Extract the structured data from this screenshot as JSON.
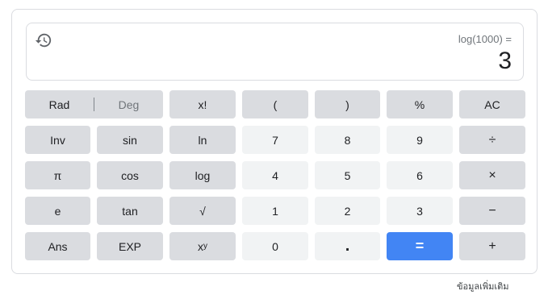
{
  "display": {
    "expression": "log(1000) =",
    "result": "3"
  },
  "buttons": {
    "rad": "Rad",
    "deg": "Deg",
    "factorial": "x!",
    "open_paren": "(",
    "close_paren": ")",
    "percent": "%",
    "all_clear": "AC",
    "inv": "Inv",
    "sin": "sin",
    "ln": "ln",
    "seven": "7",
    "eight": "8",
    "nine": "9",
    "divide": "÷",
    "pi": "π",
    "cos": "cos",
    "log": "log",
    "four": "4",
    "five": "5",
    "six": "6",
    "multiply": "×",
    "e": "e",
    "tan": "tan",
    "sqrt": "√",
    "one": "1",
    "two": "2",
    "three": "3",
    "minus": "−",
    "ans": "Ans",
    "exp": "EXP",
    "power_base": "x",
    "power_exp": "y",
    "zero": "0",
    "decimal": ".",
    "equals": "=",
    "plus": "+"
  },
  "footer": {
    "more_info": "ข้อมูลเพิ่มเติม"
  },
  "icons": {
    "history": "history-icon"
  },
  "colors": {
    "function_key": "#dadce0",
    "number_key": "#f1f3f4",
    "equals_key": "#4285f4"
  }
}
